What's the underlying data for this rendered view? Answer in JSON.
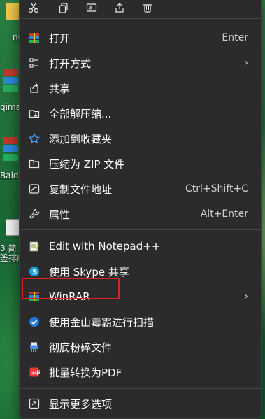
{
  "desktop": {
    "labels": [
      "ne",
      "qima",
      "Baidu",
      "3 简",
      "签排序"
    ]
  },
  "menu": {
    "items": [
      {
        "label": "打开",
        "shortcut": "Enter"
      },
      {
        "label": "打开方式",
        "submenu": "›"
      },
      {
        "label": "共享"
      },
      {
        "label": "全部解压缩..."
      },
      {
        "label": "添加到收藏夹"
      },
      {
        "label": "压缩为 ZIP 文件"
      },
      {
        "label": "复制文件地址",
        "shortcut": "Ctrl+Shift+C"
      },
      {
        "label": "属性",
        "shortcut": "Alt+Enter"
      },
      {
        "label": "Edit with Notepad++"
      },
      {
        "label": "使用 Skype 共享"
      },
      {
        "label": "WinRAR",
        "submenu": "›"
      },
      {
        "label": "使用金山毒霸进行扫描"
      },
      {
        "label": "彻底粉碎文件"
      },
      {
        "label": "批量转换为PDF"
      },
      {
        "label": "显示更多选项"
      }
    ]
  },
  "colors": {
    "menu_bg": "#2b2b2b",
    "highlight": "#e02020",
    "text": "#ffffff",
    "shortcut_text": "#cfcfcf"
  }
}
